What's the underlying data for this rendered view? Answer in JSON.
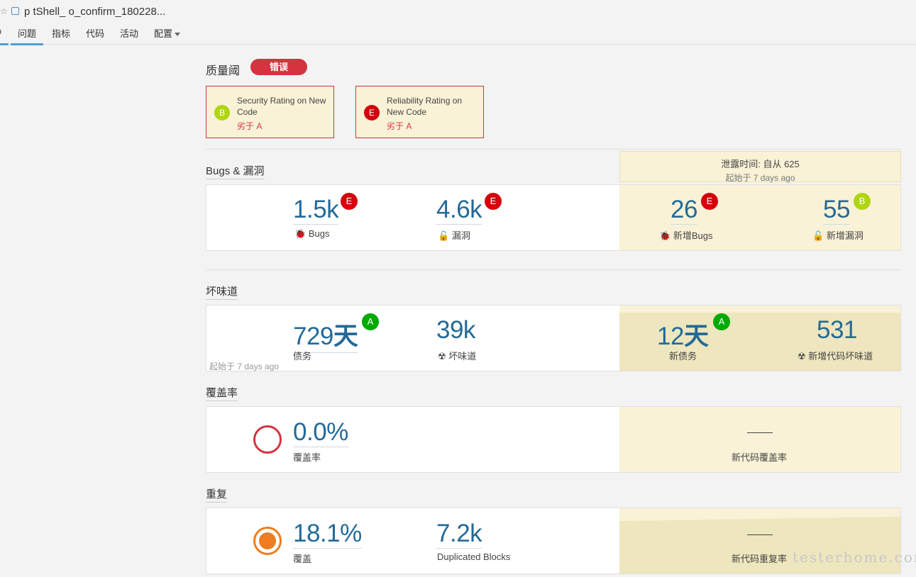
{
  "header": {
    "project_title": "p      tShell_   o_confirm_180228...",
    "nav": [
      "问题",
      "指标",
      "代码",
      "活动",
      "配置"
    ],
    "nav_cut": "一"
  },
  "quality_gate": {
    "label": "质量阈",
    "status": "错误",
    "conditions": [
      {
        "rating": "B",
        "text": "Security Rating on New Code",
        "detail": "劣于 A"
      },
      {
        "rating": "E",
        "text": "Reliability Rating on New Code",
        "detail": "劣于 A"
      }
    ]
  },
  "leak_period": {
    "line1": "泄露时间: 自从 625",
    "line2": "起始于 7 days ago"
  },
  "bugs": {
    "title": "Bugs & 漏洞",
    "bugs": {
      "value": "1.5k",
      "rating": "E",
      "label": "Bugs"
    },
    "vulns": {
      "value": "4.6k",
      "rating": "E",
      "label": "漏洞"
    },
    "new_bugs": {
      "value": "26",
      "rating": "E",
      "label": "新增Bugs"
    },
    "new_vulns": {
      "value": "55",
      "rating": "B",
      "label": "新增漏洞"
    }
  },
  "smells": {
    "title": "坏味道",
    "debt": {
      "value": "729",
      "unit": "天",
      "rating": "A",
      "label": "债务"
    },
    "smells": {
      "value": "39k",
      "label": "坏味道"
    },
    "since": "起始于 7 days ago",
    "new_debt": {
      "value": "12",
      "unit": "天",
      "rating": "A",
      "label": "新债务"
    },
    "new_smells": {
      "value": "531",
      "label": "新增代码坏味道"
    }
  },
  "coverage": {
    "title": "覆盖率",
    "value": "0.0%",
    "label": "覆盖率",
    "new_label": "新代码覆盖率"
  },
  "duplications": {
    "title": "重复",
    "value": "18.1%",
    "label": "覆盖",
    "blocks": {
      "value": "7.2k",
      "label": "Duplicated Blocks"
    },
    "new_label": "新代码重复率"
  },
  "watermark": "testerhome.com",
  "colors": {
    "error": "#d4333f",
    "rating_e": "#d4000b",
    "rating_b": "#b0d513",
    "rating_a": "#00aa00",
    "measure": "#236a97",
    "leak_bg": "#f9f2d7"
  },
  "icons": {
    "bug": "bug-icon",
    "vulnerability": "lock-icon",
    "code_smell": "radiation-icon"
  }
}
